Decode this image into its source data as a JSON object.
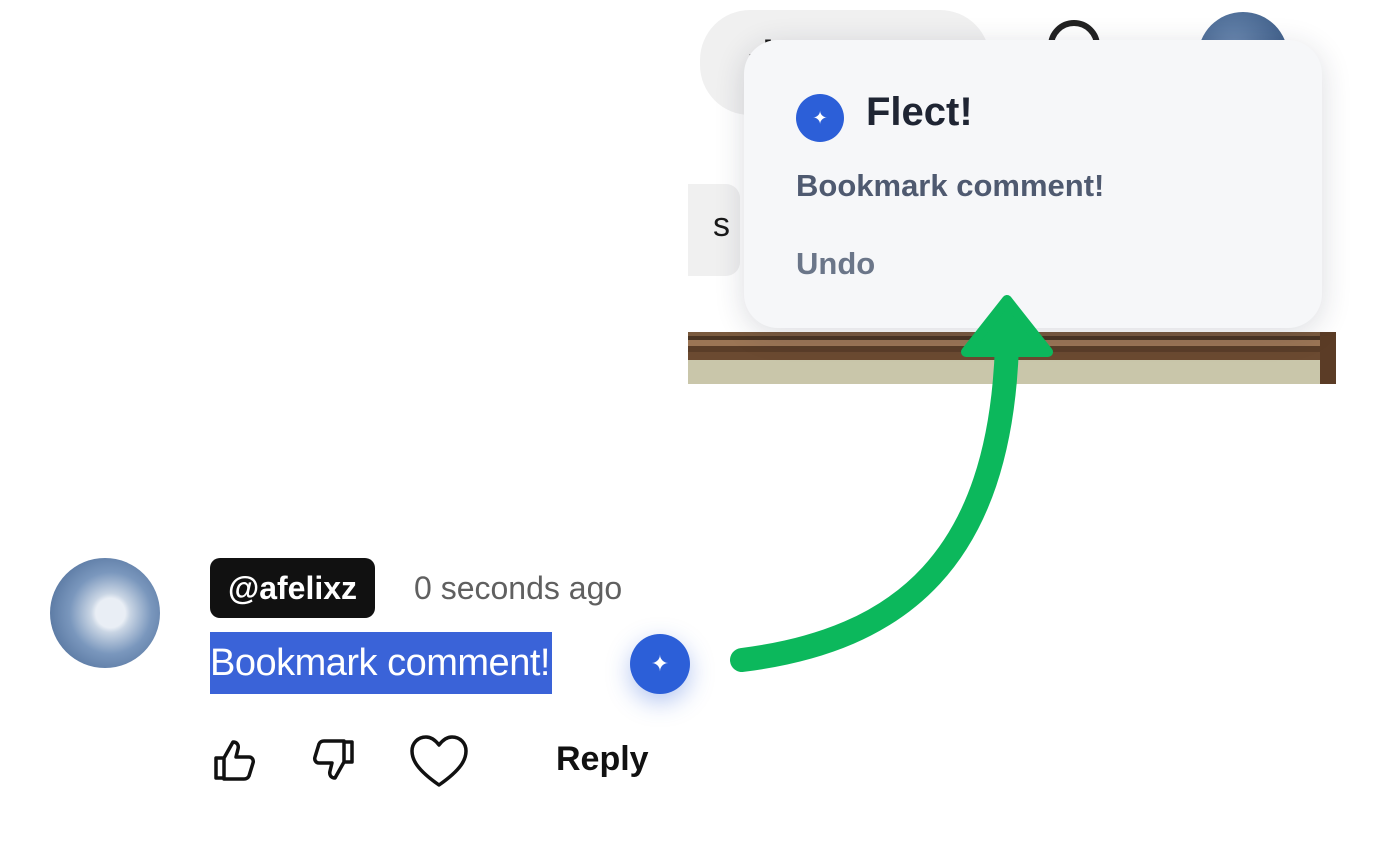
{
  "background": {
    "search_glyph": "-!",
    "chip_text": "s"
  },
  "toast": {
    "title": "Flect!",
    "message": "Bookmark comment!",
    "undo_label": "Undo",
    "logo_icon": "sparkle-icon",
    "accent_color": "#2c5fd8"
  },
  "comment": {
    "handle": "@afelixz",
    "timestamp": "0 seconds ago",
    "text": "Bookmark comment!",
    "reply_label": "Reply",
    "actions": [
      "thumbs-up-icon",
      "thumbs-down-icon",
      "heart-icon"
    ]
  },
  "annotation": {
    "arrow_color": "#0cb85c"
  }
}
